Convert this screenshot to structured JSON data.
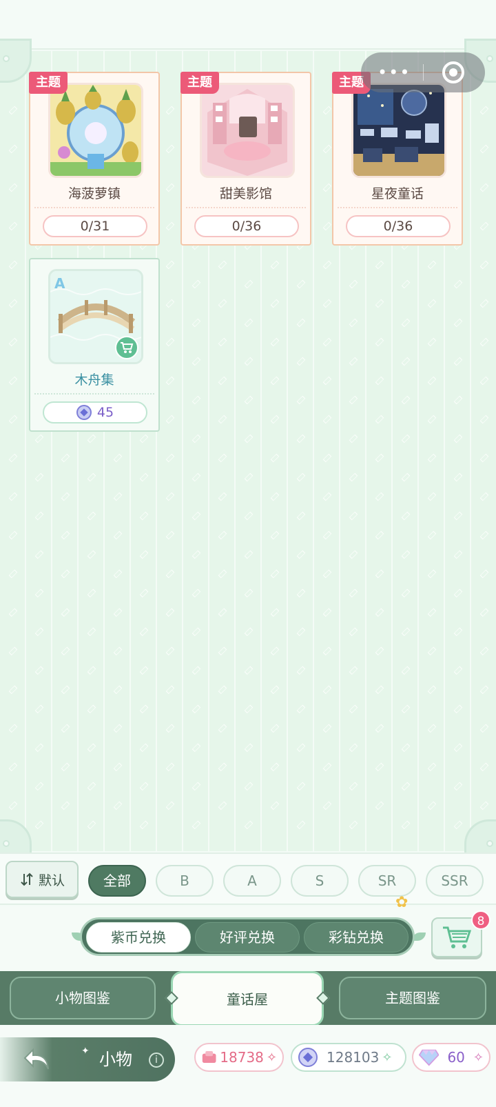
{
  "top_tags": {
    "theme": "主题"
  },
  "theme_cards": [
    {
      "name": "海菠萝镇",
      "progress": "0/31"
    },
    {
      "name": "甜美影馆",
      "progress": "0/36"
    },
    {
      "name": "星夜童话",
      "progress": "0/36"
    }
  ],
  "item_card": {
    "rank": "A",
    "name": "木舟集",
    "price": "45"
  },
  "sort": {
    "label": "默认"
  },
  "rarity_filters": [
    "全部",
    "B",
    "A",
    "S",
    "SR",
    "SSR"
  ],
  "exchange_tabs": [
    "紫币兑换",
    "好评兑换",
    "彩钻兑换"
  ],
  "cart": {
    "badge": "8"
  },
  "main_tabs": [
    "小物图鉴",
    "童话屋",
    "主题图鉴"
  ],
  "page": {
    "title": "小物"
  },
  "currencies": [
    {
      "icon": "ticket-icon",
      "value": "18738",
      "color": "#e46b87"
    },
    {
      "icon": "purple-coin-icon",
      "value": "128103",
      "color": "#6f7a88"
    },
    {
      "icon": "diamond-icon",
      "value": "60",
      "color": "#8a5fc9"
    }
  ],
  "colors": {
    "accent_green": "#4f7a62",
    "theme_tag": "#ec5a78",
    "coin_purple": "#7b5fc8"
  }
}
